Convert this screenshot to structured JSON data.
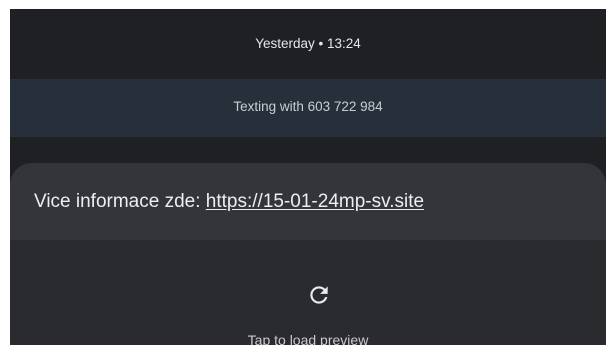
{
  "conversation": {
    "timestamp": "Yesterday • 13:24",
    "texting_with": "Texting with 603 722 984"
  },
  "message": {
    "text_prefix": "Vice informace zde: ",
    "link_text": "https://15-01-24mp-sv.site"
  },
  "preview": {
    "icon": "reload-icon",
    "label": "Tap to load preview"
  },
  "colors": {
    "background": "#1f2023",
    "banner": "#27303a",
    "bubble": "#34353a",
    "preview_area": "#2a2b2f",
    "text": "#eceef0"
  }
}
